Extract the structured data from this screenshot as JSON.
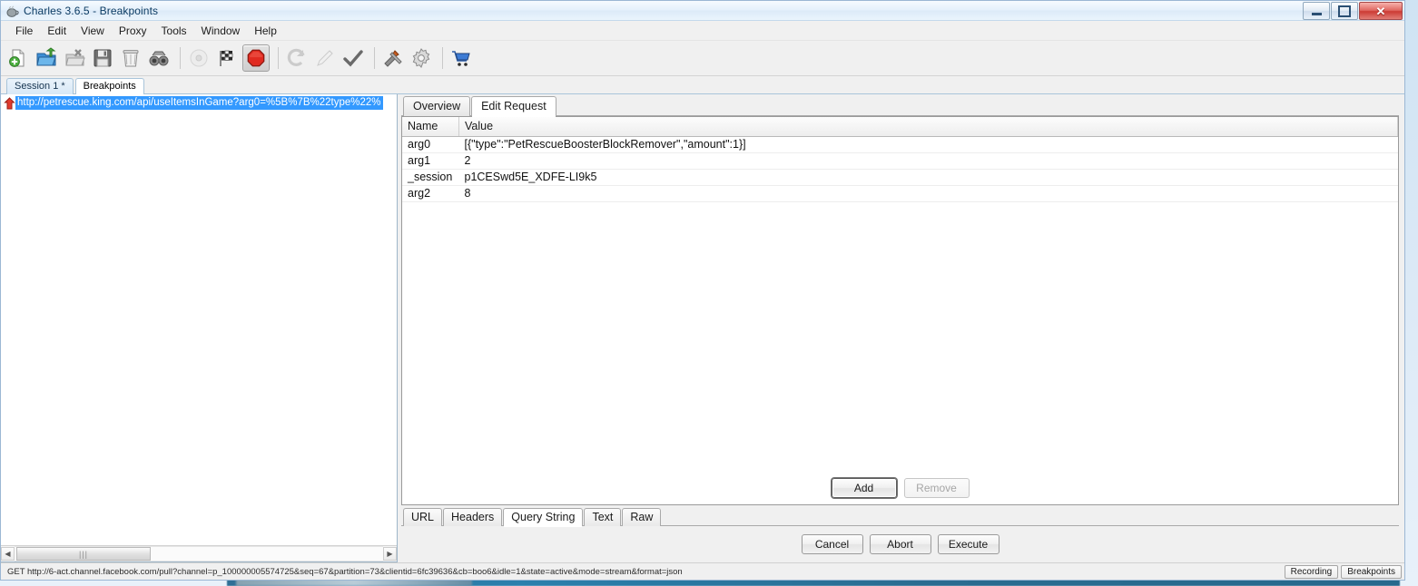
{
  "window": {
    "title": "Charles 3.6.5 - Breakpoints",
    "app_icon": "charles-cup-icon",
    "controls": {
      "minimize": "minimize-icon",
      "maximize": "maximize-icon",
      "close": "close-icon"
    }
  },
  "menubar": {
    "items": [
      "File",
      "Edit",
      "View",
      "Proxy",
      "Tools",
      "Window",
      "Help"
    ]
  },
  "toolbar": {
    "items": [
      {
        "name": "new-session-icon",
        "enabled": true,
        "selected": false
      },
      {
        "name": "open-session-icon",
        "enabled": true,
        "selected": false
      },
      {
        "name": "close-session-icon",
        "enabled": true,
        "selected": false
      },
      {
        "name": "save-session-icon",
        "enabled": true,
        "selected": false
      },
      {
        "name": "clear-session-icon",
        "enabled": true,
        "selected": false
      },
      {
        "name": "find-icon",
        "enabled": true,
        "selected": false
      },
      {
        "sep": true
      },
      {
        "name": "record-icon",
        "enabled": false,
        "selected": false
      },
      {
        "name": "throttle-icon",
        "enabled": true,
        "selected": false
      },
      {
        "name": "breakpoints-stop-icon",
        "enabled": true,
        "selected": true
      },
      {
        "sep": true
      },
      {
        "name": "repeat-icon",
        "enabled": false,
        "selected": false
      },
      {
        "name": "compose-edit-icon",
        "enabled": false,
        "selected": false
      },
      {
        "name": "validate-check-icon",
        "enabled": true,
        "selected": false
      },
      {
        "sep": true
      },
      {
        "name": "tools-icon",
        "enabled": true,
        "selected": false
      },
      {
        "name": "settings-gear-icon",
        "enabled": true,
        "selected": false
      },
      {
        "sep": true
      },
      {
        "name": "shop-cart-icon",
        "enabled": true,
        "selected": false
      }
    ]
  },
  "session_tabs": {
    "items": [
      {
        "label": "Session 1 *",
        "active": false
      },
      {
        "label": "Breakpoints",
        "active": true
      }
    ]
  },
  "breakpoint_list": {
    "rows": [
      {
        "icon": "red-up-arrow-icon",
        "url": "http://petrescue.king.com/api/useItemsInGame?arg0=%5B%7B%22type%22%"
      }
    ],
    "hscrollbar": {
      "left_arrow": "scroll-left-icon",
      "right_arrow": "scroll-right-icon",
      "grip": "|||"
    }
  },
  "request_panel": {
    "tabs": [
      {
        "label": "Overview",
        "active": false
      },
      {
        "label": "Edit Request",
        "active": true
      }
    ],
    "table": {
      "columns": [
        "Name",
        "Value"
      ],
      "rows": [
        {
          "name": "arg0",
          "value": "[{\"type\":\"PetRescueBoosterBlockRemover\",\"amount\":1}]"
        },
        {
          "name": "arg1",
          "value": "2"
        },
        {
          "name": "_session",
          "value": "p1CESwd5E_XDFE-LI9k5"
        },
        {
          "name": "arg2",
          "value": "8"
        }
      ]
    },
    "row_buttons": [
      {
        "label": "Add",
        "enabled": true,
        "focused": true
      },
      {
        "label": "Remove",
        "enabled": false,
        "focused": false
      }
    ],
    "body_tabs": [
      {
        "label": "URL",
        "active": false
      },
      {
        "label": "Headers",
        "active": false
      },
      {
        "label": "Query String",
        "active": true
      },
      {
        "label": "Text",
        "active": false
      },
      {
        "label": "Raw",
        "active": false
      }
    ],
    "action_buttons": [
      {
        "label": "Cancel"
      },
      {
        "label": "Abort"
      },
      {
        "label": "Execute"
      }
    ]
  },
  "statusbar": {
    "text": "GET http://6-act.channel.facebook.com/pull?channel=p_100000005574725&seq=67&partition=73&clientid=6fc39636&cb=boo6&idle=1&state=active&mode=stream&format=json",
    "indicators": [
      "Recording",
      "Breakpoints"
    ]
  },
  "colors": {
    "selection_blue": "#3399ff",
    "breakpoint_red": "#e02a20",
    "title_text": "#0b3b63",
    "close_button": "#cc3b34"
  }
}
